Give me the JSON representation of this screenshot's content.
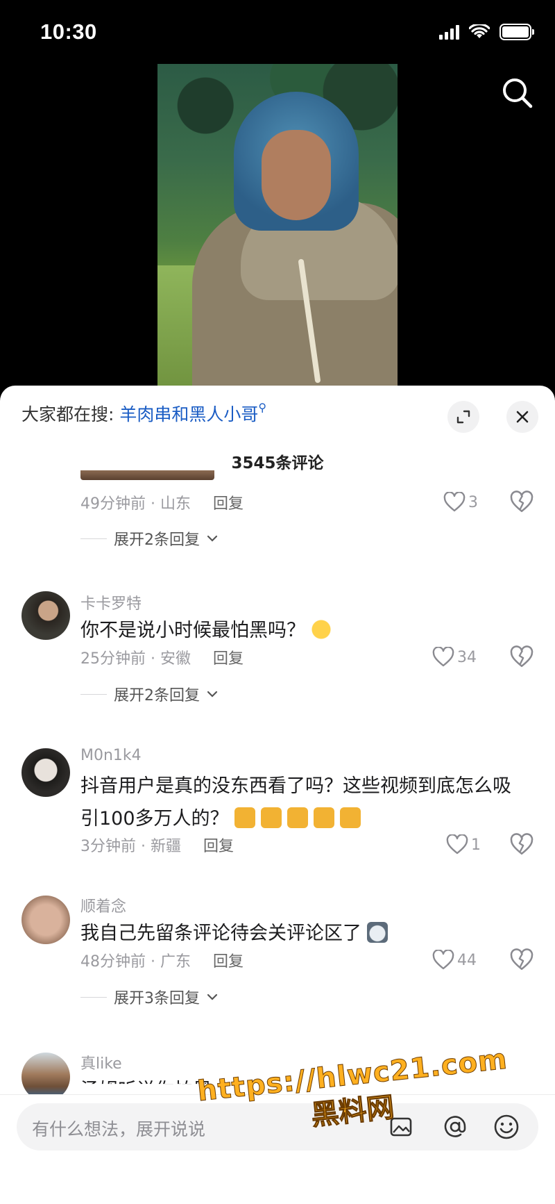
{
  "status": {
    "time": "10:30"
  },
  "sheet": {
    "search_prefix": "大家都在搜:",
    "search_term": "羊肉串和黑人小哥",
    "comment_count": "3545条评论"
  },
  "comments": [
    {
      "meta": "49分钟前 · 山东",
      "reply": "回复",
      "likes": "3",
      "expand": "展开2条回复"
    },
    {
      "user": "卡卡罗特",
      "text": "你不是说小时候最怕黑吗？",
      "meta": "25分钟前 · 安徽",
      "reply": "回复",
      "likes": "34",
      "expand": "展开2条回复"
    },
    {
      "user": "M0n1k4",
      "text_line1": "抖音用户是真的没东西看了吗？这些视频到底怎么吸",
      "text_line2": "引100多万人的？",
      "meta": "3分钟前 · 新疆",
      "reply": "回复",
      "likes": "1"
    },
    {
      "user": "顺着念",
      "text": "我自己先留条评论待会关评论区了",
      "meta": "48分钟前 · 广东",
      "reply": "回复",
      "likes": "44",
      "expand": "展开3条回复"
    },
    {
      "user": "真like",
      "text": "汤姆听说你怕黑"
    }
  ],
  "input": {
    "placeholder": "有什么想法，展开说说"
  },
  "watermark": {
    "url": "https://hlwc21.com",
    "name": "黑料网"
  },
  "colors": {
    "link": "#1a5cc4",
    "watermark": "#ffb020"
  }
}
